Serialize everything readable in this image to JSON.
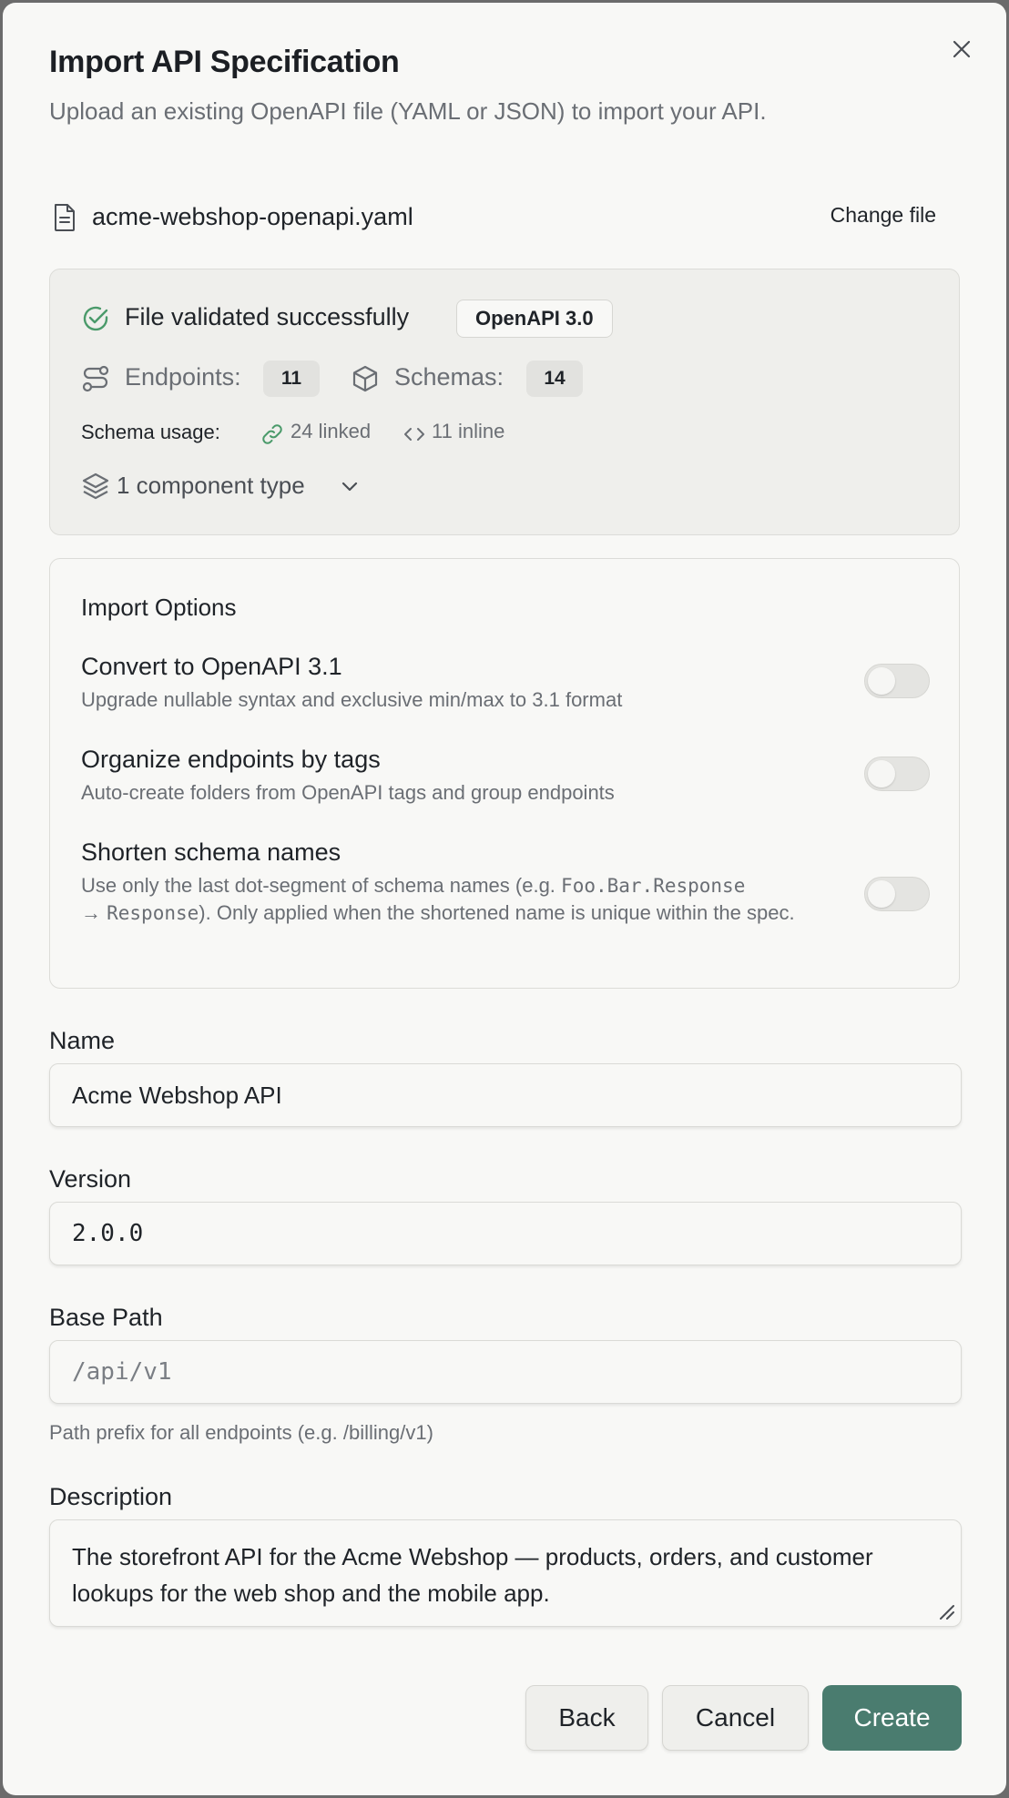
{
  "dialog": {
    "title": "Import API Specification",
    "subtitle": "Upload an existing OpenAPI file (YAML or JSON) to import your API.",
    "close_icon": "close-icon"
  },
  "file": {
    "name": "acme-webshop-openapi.yaml",
    "change_label": "Change file"
  },
  "validation": {
    "status": "File validated successfully",
    "spec_badge": "OpenAPI 3.0",
    "endpoints_label": "Endpoints:",
    "endpoints_count": "11",
    "schemas_label": "Schemas:",
    "schemas_count": "14",
    "schema_usage_label": "Schema usage:",
    "linked": "24 linked",
    "inline": "11 inline",
    "component_types": "1 component type",
    "success_color": "#4a9a6a"
  },
  "options": {
    "title": "Import Options",
    "items": [
      {
        "name": "Convert to OpenAPI 3.1",
        "description": "Upgrade nullable syntax and exclusive min/max to 3.1 format",
        "enabled": false
      },
      {
        "name": "Organize endpoints by tags",
        "description": "Auto-create folders from OpenAPI tags and group endpoints",
        "enabled": false
      },
      {
        "name": "Shorten schema names",
        "description_parts": {
          "p1": "Use only the last dot-segment of schema names (e.g. ",
          "code1": "Foo.Bar.Response",
          "p2": "→ ",
          "code2": "Response",
          "p3": "). Only applied when the shortened name is unique within the spec."
        },
        "enabled": false
      }
    ]
  },
  "form": {
    "name_label": "Name",
    "name_value": "Acme Webshop API",
    "version_label": "Version",
    "version_value": "2.0.0",
    "base_path_label": "Base Path",
    "base_path_placeholder": "/api/v1",
    "base_path_help": "Path prefix for all endpoints (e.g. /billing/v1)",
    "description_label": "Description",
    "description_value": "The storefront API for the Acme Webshop — products, orders, and customer\nlookups for the web shop and the mobile app."
  },
  "footer": {
    "back_label": "Back",
    "cancel_label": "Cancel",
    "create_label": "Create",
    "primary_color": "#4a7c6f"
  }
}
